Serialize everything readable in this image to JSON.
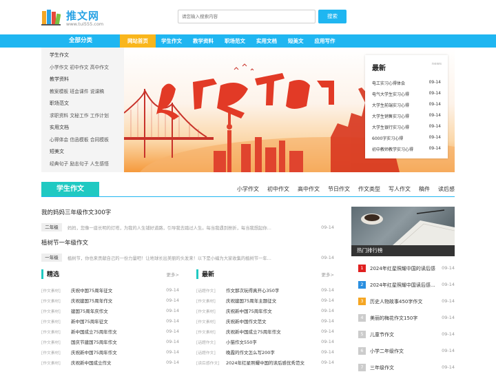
{
  "header": {
    "site_name": "推文网",
    "site_url": "www.tui555.com",
    "search_placeholder": "请您输入搜索内容",
    "search_button": "搜索"
  },
  "nav": {
    "all_categories": "全部分类",
    "items": [
      "网站首页",
      "学生作文",
      "教学资料",
      "职场范文",
      "实用文档",
      "短美文",
      "应用写作"
    ],
    "active_index": 0
  },
  "categories": [
    {
      "title": "学生作文",
      "links": "小学作文 初中作文 高中作文"
    },
    {
      "title": "教学资料",
      "links": "教案模板 班会课件 说课稿"
    },
    {
      "title": "职场范文",
      "links": "求职资料 文秘工作 工作计划"
    },
    {
      "title": "实用文档",
      "links": "心得体会 信函模板 合同模板"
    },
    {
      "title": "短美文",
      "links": "经典句子 励志句子 人生感悟"
    }
  ],
  "news": {
    "title": "最新",
    "subtitle": "news",
    "items": [
      {
        "text": "电工实习心得体会",
        "date": "09-14"
      },
      {
        "text": "电气大学生实习心得",
        "date": "09-14"
      },
      {
        "text": "大学生前端实习心得",
        "date": "09-14"
      },
      {
        "text": "大学生销售实习心得",
        "date": "09-14"
      },
      {
        "text": "大学生银行实习心得",
        "date": "09-14"
      },
      {
        "text": "6000字实习心得",
        "date": "09-14"
      },
      {
        "text": "初中教师教学实习心得",
        "date": "09-14"
      }
    ]
  },
  "section": {
    "title": "学生作文",
    "tabs": [
      "小学作文",
      "初中作文",
      "高中作文",
      "节日作文",
      "作文类型",
      "写人作文",
      "稿件",
      "读后感"
    ]
  },
  "featured": [
    {
      "title": "我的妈妈三年级作文300字",
      "tag": "二年级",
      "desc": "妈妈，您像一座长明的灯塔，为我的人生铺好道路，引导我去踏过人生。每当我遇到挫折，每当我想起你…",
      "date": "09-14"
    },
    {
      "title": "植树节一年级作文",
      "tag": "一年级",
      "desc": "植树节，你也来贡献自己的一份力量吧！让地球长出美丽的头发来！以下是小编为大家收集的植树节一年…",
      "date": "09-14"
    }
  ],
  "col_jingxuan": {
    "title": "精选",
    "more": "更多>",
    "items": [
      {
        "cat": "[作文素材]",
        "text": "庆祝中国75周年征文",
        "date": "09-14"
      },
      {
        "cat": "[作文素材]",
        "text": "庆祝建国75周年作文",
        "date": "09-14"
      },
      {
        "cat": "[作文素材]",
        "text": "建国75周年庆作文",
        "date": "09-14"
      },
      {
        "cat": "[作文素材]",
        "text": "新中国75周年征文",
        "date": "09-14"
      },
      {
        "cat": "[作文素材]",
        "text": "新中国成立75周年作文",
        "date": "09-14"
      },
      {
        "cat": "[作文素材]",
        "text": "国庆节建国75周年作文",
        "date": "09-14"
      },
      {
        "cat": "[作文素材]",
        "text": "庆祝新中国75周年作文",
        "date": "09-14"
      },
      {
        "cat": "[作文素材]",
        "text": "庆祝新中国成立作文",
        "date": "09-14"
      }
    ]
  },
  "col_zuixin": {
    "title": "最新",
    "more": "更多>",
    "items": [
      {
        "cat": "[话题作文]",
        "text": "作文那次玩得真开心350字",
        "date": "09-14"
      },
      {
        "cat": "[作文素材]",
        "text": "庆祝建国75周年主题征文",
        "date": "09-14"
      },
      {
        "cat": "[作文素材]",
        "text": "庆祝新中国75周年作文",
        "date": "09-14"
      },
      {
        "cat": "[作文素材]",
        "text": "庆祝新中国作文范文",
        "date": "09-14"
      },
      {
        "cat": "[作文素材]",
        "text": "庆祝新中国成立75周年作文",
        "date": "09-14"
      },
      {
        "cat": "[话题作文]",
        "text": "小猫作文550字",
        "date": "09-14"
      },
      {
        "cat": "[话题作文]",
        "text": "晚霞的作文怎么写200字",
        "date": "09-14"
      },
      {
        "cat": "[读后感作文]",
        "text": "2024年红星照耀中国的读后感优秀范文",
        "date": "09-14"
      }
    ]
  },
  "sidebar": {
    "hot_title": "热门排行榜",
    "items": [
      {
        "num": "1",
        "text": "2024年红星照耀中国的读后感…",
        "date": "09-14",
        "color": "#e02020"
      },
      {
        "num": "2",
        "text": "2024年红星照耀中国读后感…",
        "date": "09-14",
        "color": "#2a8fe0"
      },
      {
        "num": "3",
        "text": "历史人物故事450字作文",
        "date": "09-14",
        "color": "#f5a623"
      },
      {
        "num": "4",
        "text": "美丽的梅花作文150字",
        "date": "09-14",
        "color": "#cccccc"
      },
      {
        "num": "5",
        "text": "儿童节作文",
        "date": "09-14",
        "color": "#cccccc"
      },
      {
        "num": "6",
        "text": "小学二年级作文",
        "date": "09-14",
        "color": "#cccccc"
      },
      {
        "num": "7",
        "text": "三年级作文",
        "date": "09-14",
        "color": "#cccccc"
      }
    ]
  },
  "colors": {
    "nav_blue": "#1fb6f1",
    "nav_active": "#f9b61c",
    "section_teal": "#20c9c2"
  }
}
